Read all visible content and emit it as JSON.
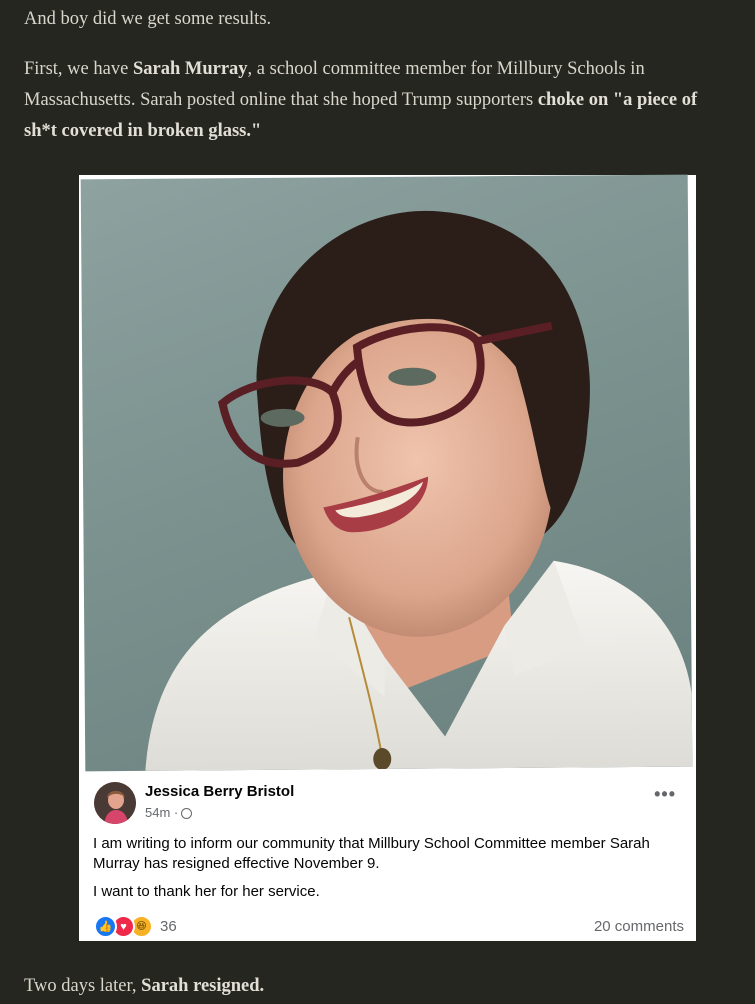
{
  "article": {
    "p1": "And boy did we get some results.",
    "p2_pre": "First, we have ",
    "p2_name": "Sarah Murray",
    "p2_mid": ", a school committee member for Millbury Schools in Massachusetts. Sarah posted online that she hoped Trump supporters ",
    "p2_quote": "choke on \"a piece of sh*t covered in broken glass.\"",
    "p3_pre": "Two days later, ",
    "p3_bold": "Sarah resigned."
  },
  "post": {
    "author": "Jessica Berry Bristol",
    "time": "54m · ",
    "more": "•••",
    "text1": "I am writing to inform our community that Millbury School Committee member Sarah Murray has resigned effective November 9.",
    "text2": "I want to thank her for her service.",
    "reaction_count": "36",
    "comments": "20 comments",
    "reactions": [
      "like-icon",
      "love-icon",
      "haha-icon"
    ],
    "reaction_glyphs": {
      "like": "👍",
      "love": "♥",
      "haha": "😆"
    }
  },
  "colors": {
    "page_bg": "#262620",
    "text": "#d9d6cc",
    "facebook_blue": "#1877f2",
    "love_red": "#f02849",
    "haha_yellow": "#f7b125"
  }
}
